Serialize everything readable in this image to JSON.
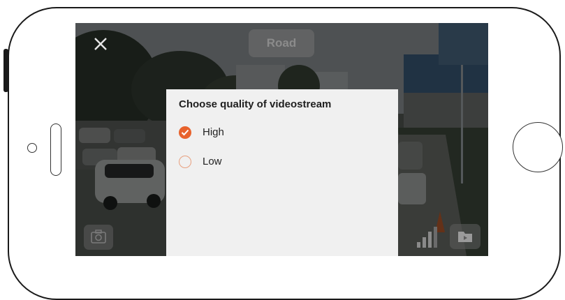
{
  "header": {
    "mode_label": "Road"
  },
  "dialog": {
    "title": "Choose quality of videostream",
    "options": [
      {
        "label": "High",
        "selected": true
      },
      {
        "label": "Low",
        "selected": false
      }
    ]
  },
  "icons": {
    "close": "close-icon",
    "camera": "camera-icon",
    "signal": "signal-icon",
    "folder": "folder-icon"
  },
  "colors": {
    "accent": "#e8622c",
    "dialog_bg": "#f0f0f0",
    "overlay_pill": "#696969"
  }
}
